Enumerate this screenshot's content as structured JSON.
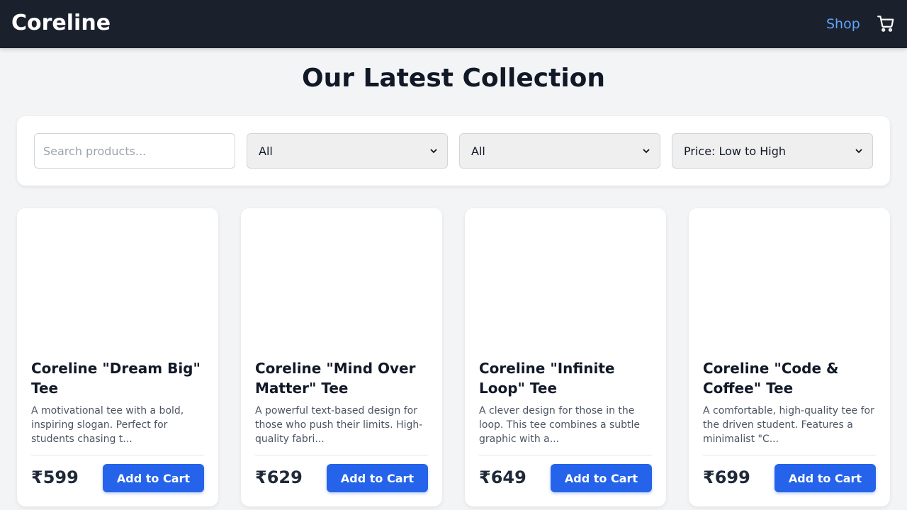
{
  "navbar": {
    "brand": "Coreline",
    "shop_link": "Shop",
    "cart_icon": "shopping-cart-icon"
  },
  "page_title": "Our Latest Collection",
  "filters": {
    "search_placeholder": "Search products...",
    "search_value": "",
    "select_1": "All",
    "select_2": "All",
    "sort": "Price: Low to High"
  },
  "products": [
    {
      "title": "Coreline \"Dream Big\" Tee",
      "description": "A motivational tee with a bold, inspiring slogan. Perfect for students chasing t...",
      "price": "₹599",
      "button": "Add to Cart"
    },
    {
      "title": "Coreline \"Mind Over Matter\" Tee",
      "description": "A powerful text-based design for those who push their limits. High-quality fabri...",
      "price": "₹629",
      "button": "Add to Cart"
    },
    {
      "title": "Coreline \"Infinite Loop\" Tee",
      "description": "A clever design for those in the loop. This tee combines a subtle graphic with a...",
      "price": "₹649",
      "button": "Add to Cart"
    },
    {
      "title": "Coreline \"Code & Coffee\" Tee",
      "description": "A comfortable, high-quality tee for the driven student. Features a minimalist \"C...",
      "price": "₹699",
      "button": "Add to Cart"
    }
  ],
  "colors": {
    "navbar_bg": "#1a202c",
    "accent": "#2563eb",
    "link": "#60a5fa",
    "page_bg": "#f3f4f6"
  }
}
